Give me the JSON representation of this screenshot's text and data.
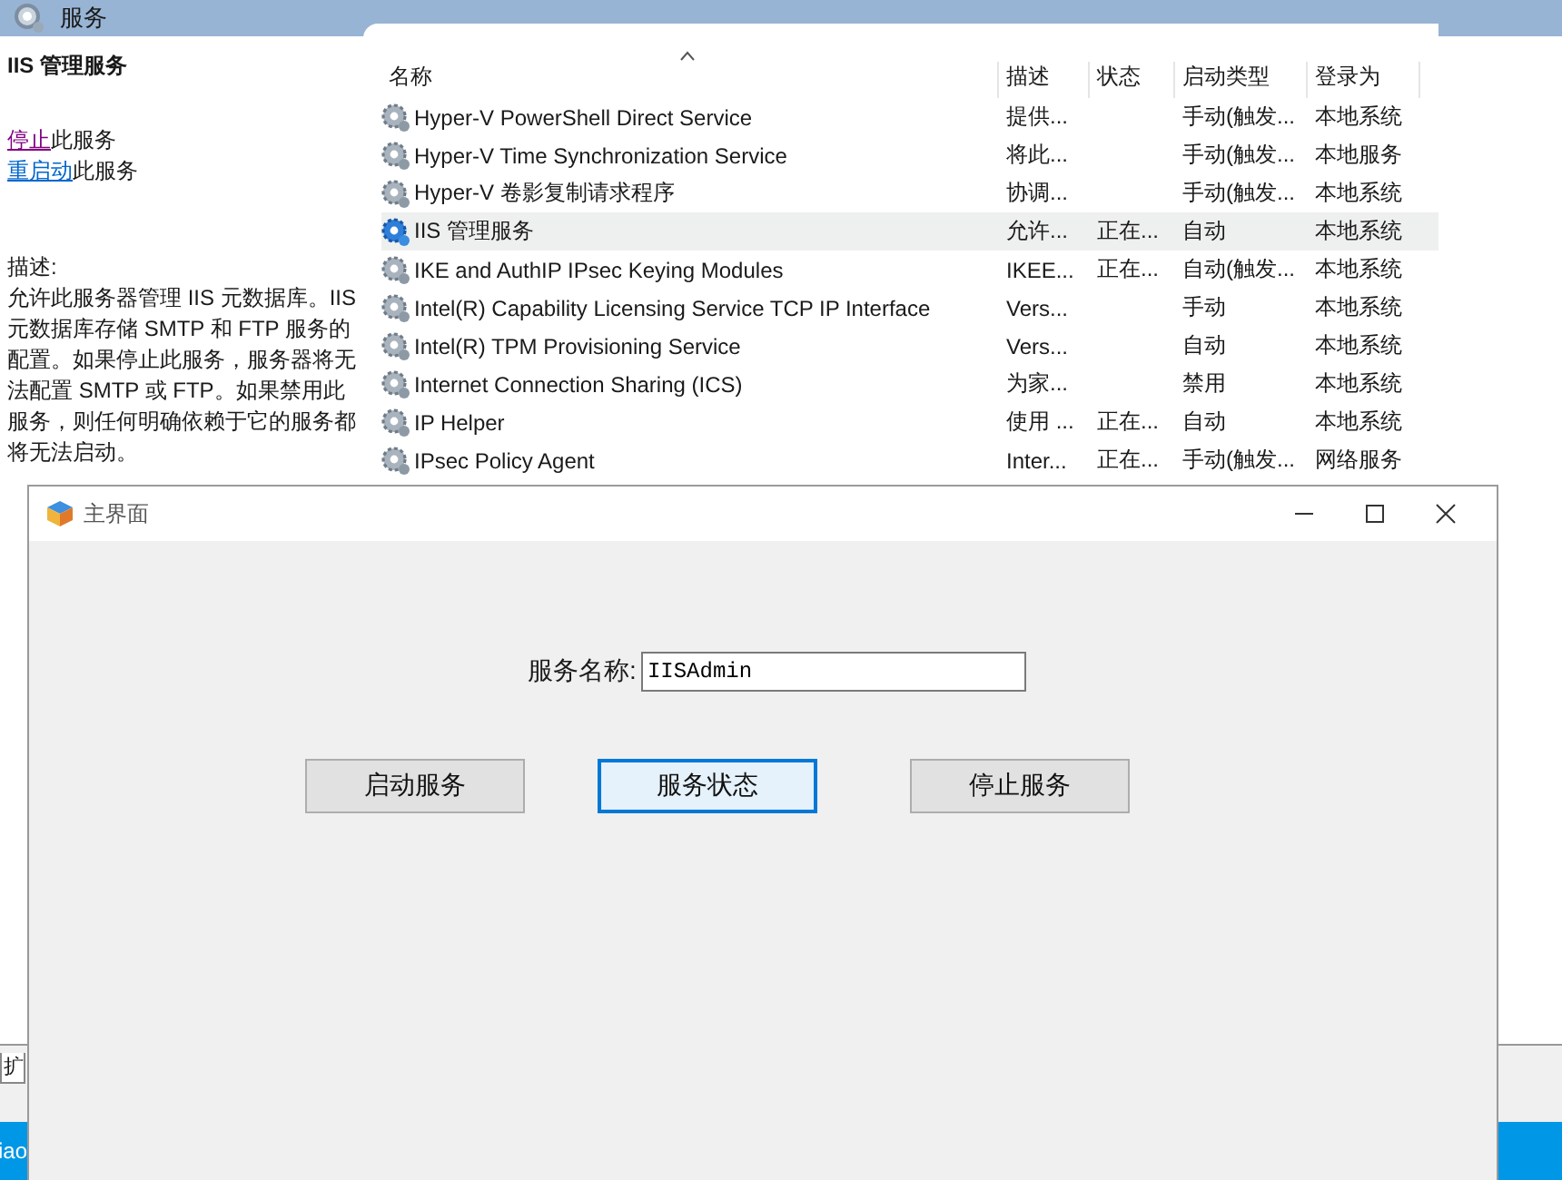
{
  "services_window": {
    "title": "服务",
    "detail": {
      "heading": "IIS 管理服务",
      "links": [
        {
          "link": "停止",
          "text": "此服务",
          "visited": true
        },
        {
          "link": "重启动",
          "text": "此服务",
          "visited": false
        }
      ],
      "description_label": "描述:",
      "description": "允许此服务器管理 IIS 元数据库。IIS 元数据库存储 SMTP 和 FTP 服务的配置。如果停止此服务，服务器将无法配置 SMTP 或 FTP。如果禁用此服务，则任何明确依赖于它的服务都将无法启动。"
    },
    "table": {
      "columns": [
        "名称",
        "描述",
        "状态",
        "启动类型",
        "登录为"
      ],
      "rows": [
        {
          "cells": [
            "Hyper-V PowerShell Direct Service",
            "提供...",
            "",
            "手动(触发...",
            "本地系统"
          ],
          "selected": false
        },
        {
          "cells": [
            "Hyper-V Time Synchronization Service",
            "将此...",
            "",
            "手动(触发...",
            "本地服务"
          ],
          "selected": false
        },
        {
          "cells": [
            "Hyper-V 卷影复制请求程序",
            "协调...",
            "",
            "手动(触发...",
            "本地系统"
          ],
          "selected": false
        },
        {
          "cells": [
            "IIS 管理服务",
            "允许...",
            "正在...",
            "自动",
            "本地系统"
          ],
          "selected": true
        },
        {
          "cells": [
            "IKE and AuthIP IPsec Keying Modules",
            "IKEE...",
            "正在...",
            "自动(触发...",
            "本地系统"
          ],
          "selected": false
        },
        {
          "cells": [
            "Intel(R) Capability Licensing Service TCP IP Interface",
            "Vers...",
            "",
            "手动",
            "本地系统"
          ],
          "selected": false
        },
        {
          "cells": [
            "Intel(R) TPM Provisioning Service",
            "Vers...",
            "",
            "自动",
            "本地系统"
          ],
          "selected": false
        },
        {
          "cells": [
            "Internet Connection Sharing (ICS)",
            "为家...",
            "",
            "禁用",
            "本地系统"
          ],
          "selected": false
        },
        {
          "cells": [
            "IP Helper",
            "使用 ...",
            "正在...",
            "自动",
            "本地系统"
          ],
          "selected": false
        },
        {
          "cells": [
            "IPsec Policy Agent",
            "Inter...",
            "正在...",
            "手动(触发...",
            "网络服务"
          ],
          "selected": false
        }
      ]
    }
  },
  "bottom_tab": "扩",
  "taskbar_text": "iao",
  "dialog": {
    "title": "主界面",
    "field": {
      "label": "服务名称:",
      "value": "IISAdmin"
    },
    "buttons": [
      {
        "label": "启动服务",
        "focused": false
      },
      {
        "label": "服务状态",
        "focused": true
      },
      {
        "label": "停止服务",
        "focused": false
      }
    ]
  }
}
